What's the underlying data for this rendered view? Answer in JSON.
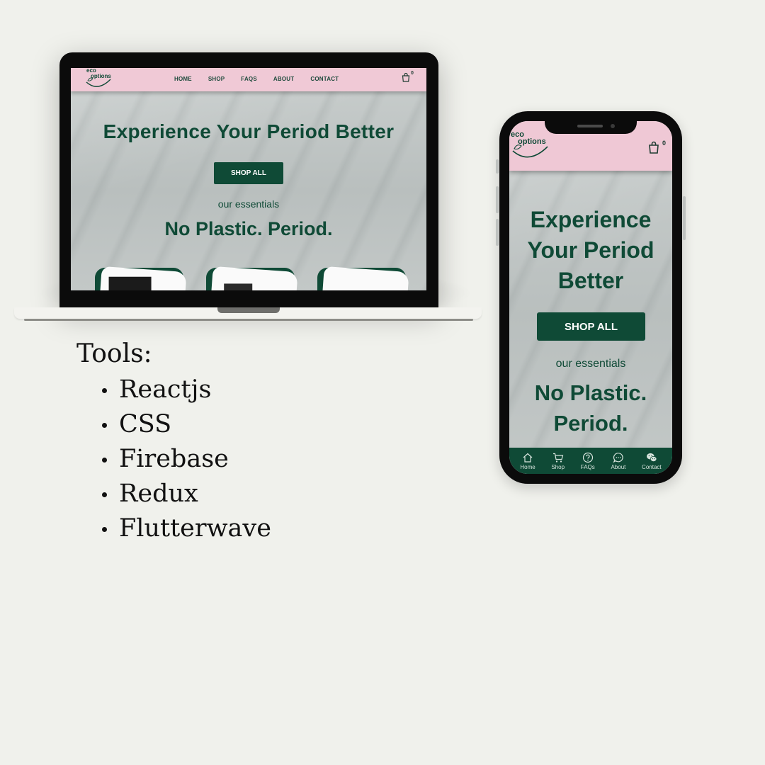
{
  "brand": {
    "logo_line1": "eco",
    "logo_line2": "options"
  },
  "laptop": {
    "nav": {
      "items": [
        "HOME",
        "SHOP",
        "FAQS",
        "ABOUT",
        "CONTACT"
      ],
      "cart_count": "0"
    },
    "hero": {
      "title": "Experience Your Period Better",
      "button": "SHOP ALL",
      "subtitle": "our essentials",
      "slogan": "No Plastic. Period."
    }
  },
  "phone": {
    "nav": {
      "cart_count": "0"
    },
    "hero": {
      "title_lines": [
        "Experience",
        "Your Period",
        "Better"
      ],
      "button": "SHOP ALL",
      "subtitle": "our essentials",
      "slogan_lines": [
        "No Plastic.",
        "Period."
      ]
    },
    "tabbar": [
      {
        "label": "Home",
        "icon": "home-icon"
      },
      {
        "label": "Shop",
        "icon": "cart-icon"
      },
      {
        "label": "FAQs",
        "icon": "question-icon"
      },
      {
        "label": "About",
        "icon": "chat-icon"
      },
      {
        "label": "Contact",
        "icon": "wechat-icon"
      }
    ]
  },
  "tools": {
    "heading": "Tools:",
    "items": [
      "Reactjs",
      "CSS",
      "Firebase",
      "Redux",
      "Flutterwave"
    ]
  },
  "colors": {
    "background": "#f0f1ec",
    "nav_pink": "#f0c9d6",
    "brand_green": "#0f4a36"
  }
}
